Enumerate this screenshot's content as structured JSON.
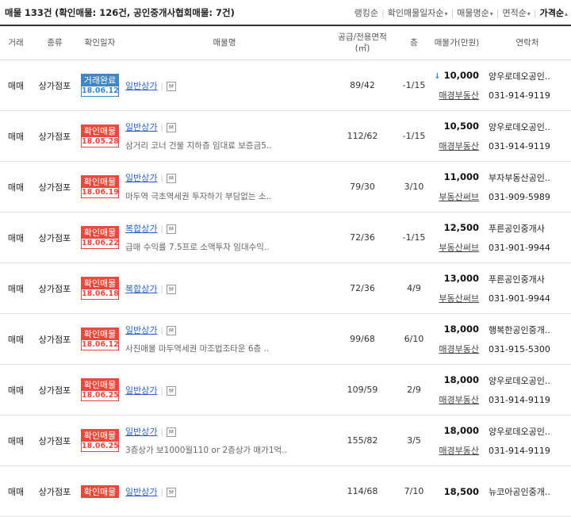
{
  "summary": {
    "label": "매물",
    "count": "133건",
    "detail": "(확인매물: 126건, 공인중개사협회매물: 7건)"
  },
  "sort_tabs": [
    {
      "label": "랭킹순",
      "arrow": ""
    },
    {
      "label": "확인매물일자순",
      "arrow": "▾"
    },
    {
      "label": "매물명순",
      "arrow": "▾"
    },
    {
      "label": "면적순",
      "arrow": "▾"
    },
    {
      "label": "가격순",
      "arrow": "▴"
    }
  ],
  "columns": {
    "deal": "거래",
    "kind": "종류",
    "date": "확인일자",
    "name": "매물명",
    "area_line1": "공급/전용면적",
    "area_line2": "(㎡)",
    "floor": "층",
    "price": "매물가(만원)",
    "contact": "연락처"
  },
  "listings": [
    {
      "deal": "매매",
      "kind": "상가점포",
      "badge_label": "거래완료",
      "badge_type": "done",
      "date": "18.06.12",
      "name": "일반상가",
      "map": "M",
      "desc": "",
      "area": "89/42",
      "floor": "-1/15",
      "price_prefix": "↓",
      "price": "10,000",
      "agent_site": "매경부동산",
      "agent": "양우로데오공인..",
      "phone": "031-914-9119"
    },
    {
      "deal": "매매",
      "kind": "상가점포",
      "badge_label": "확인매물",
      "badge_type": "confirm",
      "date": "18.05.28",
      "name": "일반상가",
      "map": "M",
      "desc": "삼거리 코너 건물 지하층 임대료 보증금5..",
      "area": "112/62",
      "floor": "-1/15",
      "price_prefix": "",
      "price": "10,500",
      "agent_site": "매경부동산",
      "agent": "양우로데오공인..",
      "phone": "031-914-9119"
    },
    {
      "deal": "매매",
      "kind": "상가점포",
      "badge_label": "확인매물",
      "badge_type": "confirm",
      "date": "18.06.19",
      "name": "일반상가",
      "map": "M",
      "desc": "마두역 극초역세권 투자하기 부담없는 소..",
      "area": "79/30",
      "floor": "3/10",
      "price_prefix": "",
      "price": "11,000",
      "agent_site": "부동산써브",
      "agent": "부자부동산공인..",
      "phone": "031-909-5989"
    },
    {
      "deal": "매매",
      "kind": "상가점포",
      "badge_label": "확인매물",
      "badge_type": "confirm",
      "date": "18.06.22",
      "name": "복합상가",
      "map": "M",
      "desc": "급매 수익률 7.5프로 소액투자 임대수익..",
      "area": "72/36",
      "floor": "-1/15",
      "price_prefix": "",
      "price": "12,500",
      "agent_site": "부동산써브",
      "agent": "푸른공인중개사",
      "phone": "031-901-9944"
    },
    {
      "deal": "매매",
      "kind": "상가점포",
      "badge_label": "확인매물",
      "badge_type": "confirm",
      "date": "18.06.18",
      "name": "복합상가",
      "map": "M",
      "desc": "",
      "area": "72/36",
      "floor": "4/9",
      "price_prefix": "",
      "price": "13,000",
      "agent_site": "부동산써브",
      "agent": "푸른공인중개사",
      "phone": "031-901-9944"
    },
    {
      "deal": "매매",
      "kind": "상가점포",
      "badge_label": "확인매물",
      "badge_type": "confirm",
      "date": "18.06.12",
      "name": "일반상가",
      "map": "M",
      "desc": "사진매물 마두역세권 마조법조타운 6층 ..",
      "area": "99/68",
      "floor": "6/10",
      "price_prefix": "",
      "price": "18,000",
      "agent_site": "매경부동산",
      "agent": "행복한공인중개..",
      "phone": "031-915-5300"
    },
    {
      "deal": "매매",
      "kind": "상가점포",
      "badge_label": "확인매물",
      "badge_type": "confirm",
      "date": "18.06.25",
      "name": "일반상가",
      "map": "M",
      "desc": "",
      "area": "109/59",
      "floor": "2/9",
      "price_prefix": "",
      "price": "18,000",
      "agent_site": "매경부동산",
      "agent": "양우로데오공인..",
      "phone": "031-914-9119"
    },
    {
      "deal": "매매",
      "kind": "상가점포",
      "badge_label": "확인매물",
      "badge_type": "confirm",
      "date": "18.06.25",
      "name": "일반상가",
      "map": "M",
      "desc": "3층상가 보1000월110 or 2층상가 매가1억..",
      "area": "155/82",
      "floor": "3/5",
      "price_prefix": "",
      "price": "18,000",
      "agent_site": "매경부동산",
      "agent": "양우로데오공인..",
      "phone": "031-914-9119"
    },
    {
      "deal": "매매",
      "kind": "상가점포",
      "badge_label": "확인매물",
      "badge_type": "confirm",
      "date": "",
      "name": "일반상가",
      "map": "M",
      "desc": "",
      "area": "114/68",
      "floor": "7/10",
      "price_prefix": "",
      "price": "18,500",
      "agent_site": "",
      "agent": "뉴코아공인중개..",
      "phone": ""
    }
  ]
}
